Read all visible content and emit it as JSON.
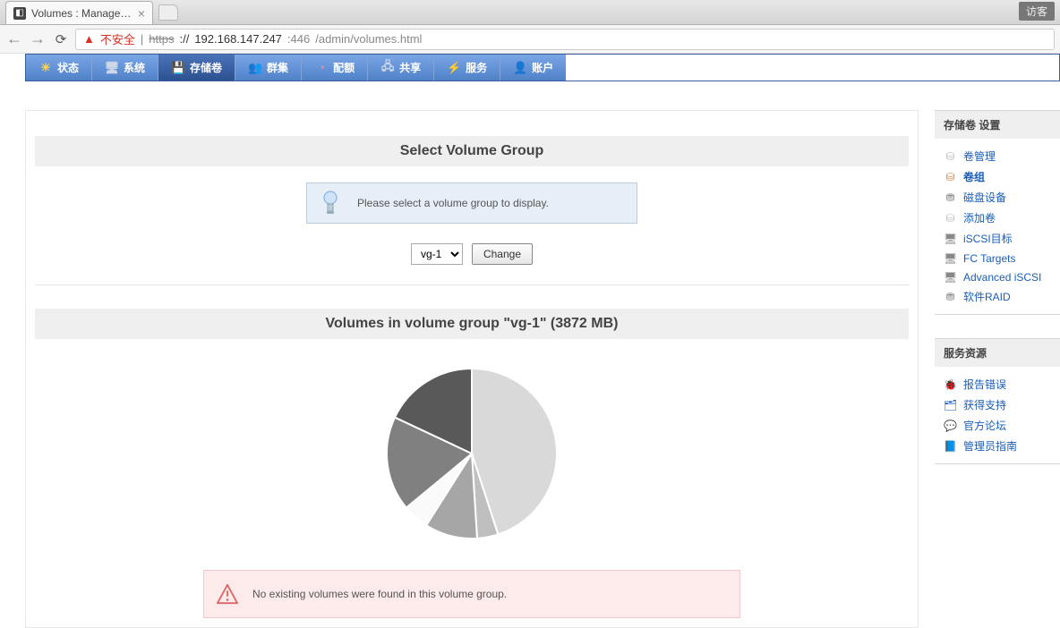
{
  "browser": {
    "tab_title": "Volumes : Manage Vol...",
    "guest": "访客",
    "not_secure": "不安全",
    "proto": "https",
    "sep": "://",
    "host": "192.168.147.247",
    "port": ":446",
    "path": "/admin/volumes.html"
  },
  "nav": {
    "status": "状态",
    "system": "系统",
    "volumes": "存储卷",
    "cluster": "群集",
    "quota": "配额",
    "share": "共享",
    "services": "服务",
    "accounts": "账户"
  },
  "main": {
    "select_title": "Select Volume Group",
    "hint": "Please select a volume group to display.",
    "vg_selected": "vg-1",
    "change_btn": "Change",
    "volumes_title": "Volumes in volume group \"vg-1\" (3872 MB)",
    "no_volumes": "No existing volumes were found in this volume group."
  },
  "sidebar": {
    "settings_title": "存储卷 设置",
    "items": [
      {
        "label": "卷管理",
        "bold": false
      },
      {
        "label": "卷组",
        "bold": true
      },
      {
        "label": "磁盘设备",
        "bold": false
      },
      {
        "label": "添加卷",
        "bold": false
      },
      {
        "label": "iSCSI目标",
        "bold": false
      },
      {
        "label": "FC Targets",
        "bold": false
      },
      {
        "label": "Advanced iSCSI",
        "bold": false
      },
      {
        "label": "软件RAID",
        "bold": false
      }
    ],
    "resources_title": "服务资源",
    "resources": [
      {
        "label": "报告错误"
      },
      {
        "label": "获得支持"
      },
      {
        "label": "官方论坛"
      },
      {
        "label": "管理员指南"
      }
    ]
  },
  "chart_data": {
    "type": "pie",
    "title": "Volumes in volume group \"vg-1\" (3872 MB)",
    "total_mb": 3872,
    "series": [
      {
        "name": "slice-1",
        "value": 45,
        "color": "#d9d9d9"
      },
      {
        "name": "slice-2",
        "value": 4,
        "color": "#bfbfbf"
      },
      {
        "name": "slice-3",
        "value": 10,
        "color": "#a6a6a6"
      },
      {
        "name": "slice-4",
        "value": 5,
        "color": "#fafafa"
      },
      {
        "name": "slice-5",
        "value": 18,
        "color": "#808080"
      },
      {
        "name": "slice-6",
        "value": 18,
        "color": "#595959"
      }
    ]
  }
}
